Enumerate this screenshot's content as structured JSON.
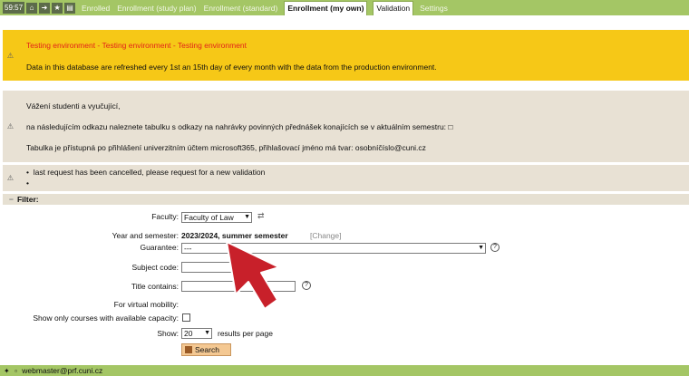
{
  "topbar": {
    "timer": "59:57",
    "icons": [
      "home-icon",
      "login-icon",
      "star-icon",
      "print-icon"
    ],
    "tabs": [
      {
        "label": "Enrolled",
        "active": false
      },
      {
        "label": "Enrollment (study plan)",
        "active": false
      },
      {
        "label": "Enrollment (standard)",
        "active": false
      },
      {
        "label": "Enrollment (my own)",
        "active": true
      },
      {
        "label": "Validation",
        "active": false
      },
      {
        "label": "Settings",
        "active": false
      }
    ]
  },
  "messages": {
    "testing_title": "Testing environment - Testing environment - Testing environment",
    "testing_text": "Data in this database are refreshed every 1st an 15th day of every month with the data from the production environment.",
    "greeting": "Vážení studenti a vyučující,",
    "info_line1": "na následujícím odkazu naleznete tabulku s odkazy na nahrávky povinných přednášek konajících se v aktuálním semestru: □",
    "info_line2": "Tabulka je přístupná po přihlášení univerzitním účtem microsoft365, přihlašovací jméno má tvar: osobníčíslo@cuni.cz",
    "notice_1": "last request has been cancelled, please request for a new validation",
    "notice_2": ""
  },
  "filter": {
    "header": "Filter:",
    "collapse_glyph": "−",
    "faculty_label": "Faculty:",
    "faculty_value": "Faculty of Law",
    "year_label": "Year and semester:",
    "year_value": "2023/2024, summer semester",
    "change_link": "[Change]",
    "guarantee_label": "Guarantee:",
    "guarantee_value": "---",
    "subject_code_label": "Subject code:",
    "subject_code_value": "",
    "title_label": "Title contains:",
    "title_value": "",
    "virtual_label": "For virtual mobility:",
    "capacity_label": "Show only courses with available capacity:",
    "show_label": "Show:",
    "show_value": "20",
    "per_page": "results per page",
    "search_button": "Search"
  },
  "footer": {
    "email": "webmaster@prf.cuni.cz"
  },
  "colors": {
    "topbar_green": "#a4c665",
    "warning_yellow": "#f6c817",
    "notice_beige": "#e8e1d4",
    "alert_red": "#e2221a",
    "pointer_red": "#c8202a"
  }
}
